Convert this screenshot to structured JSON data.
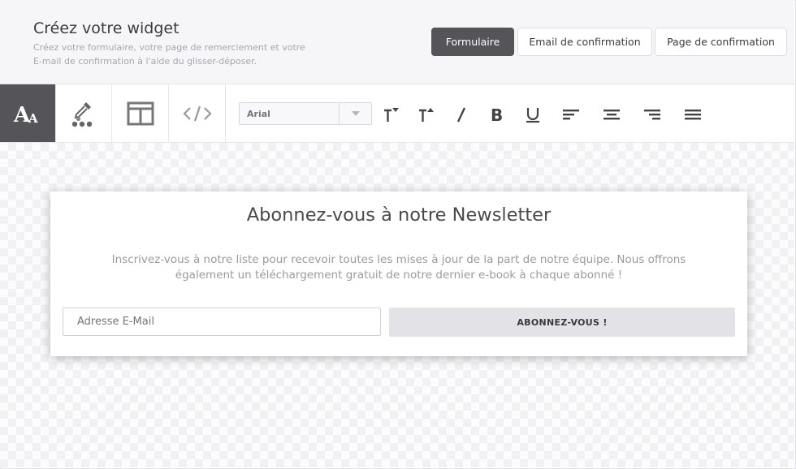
{
  "header": {
    "title": "Créez votre widget",
    "subtitle_line1": "Créez votre formulaire, votre page de remerciement et votre",
    "subtitle_line2": "E-mail de confirmation à l'aide du glisser-déposer.",
    "tabs": [
      {
        "label": "Formulaire",
        "active": true
      },
      {
        "label": "Email de confirmation",
        "active": false
      },
      {
        "label": "Page de confirmation",
        "active": false
      }
    ]
  },
  "toolbar": {
    "tools": [
      "text-style-icon",
      "color-picker-icon",
      "layout-icon",
      "code-icon"
    ],
    "font_value": "Arial",
    "format_buttons": [
      "font-size-decrease-icon",
      "font-size-increase-icon",
      "italic-icon",
      "bold-icon",
      "underline-icon",
      "align-left-icon",
      "align-center-icon",
      "align-right-icon",
      "align-justify-icon"
    ]
  },
  "widget": {
    "title": "Abonnez-vous à notre Newsletter",
    "text_line1": "Inscrivez-vous à notre liste pour recevoir toutes les mises à jour de la part de notre équipe. Nous offrons",
    "text_line2": "également un téléchargement gratuit de notre dernier e-book à chaque abonné !",
    "email_placeholder": "Adresse E-Mail",
    "subscribe_label": "ABONNEZ-VOUS !"
  },
  "colors": {
    "active_tab": "#555559",
    "header_bg": "#f6f6f9",
    "button_bg": "#e3e3e7"
  }
}
